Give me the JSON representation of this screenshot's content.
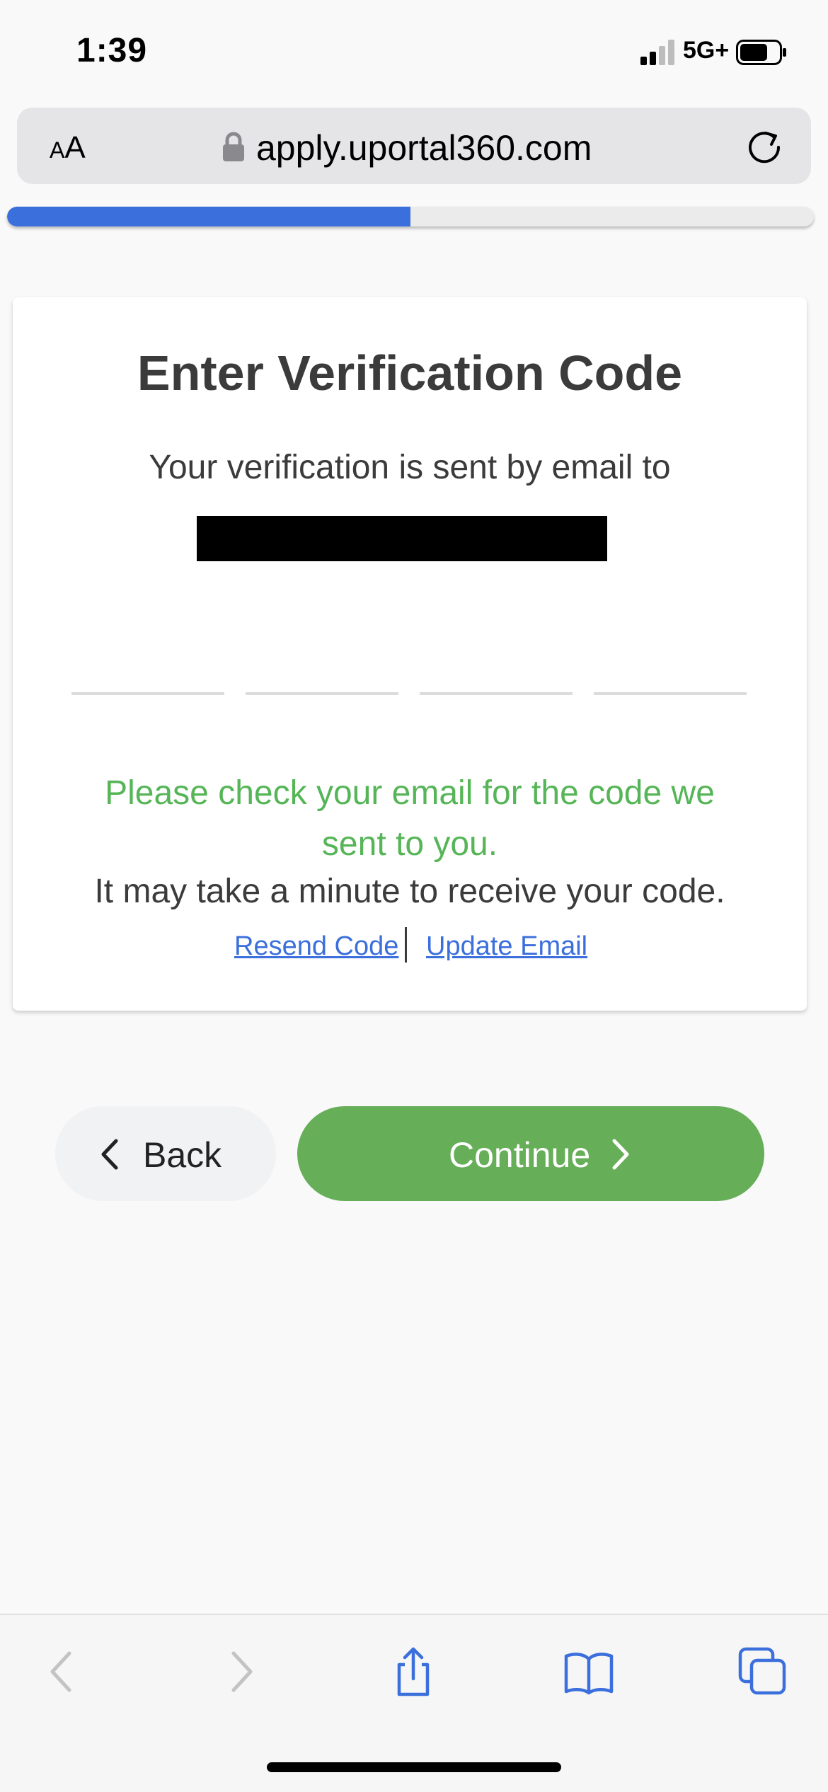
{
  "status_bar": {
    "time": "1:39",
    "network": "5G+"
  },
  "browser": {
    "aa_label_small": "A",
    "aa_label_large": "A",
    "url": "apply.uportal360.com"
  },
  "progress": {
    "fraction": 0.5
  },
  "card": {
    "title": "Enter Verification Code",
    "subtitle": "Your verification is sent by email to",
    "check_message": "Please check your email for the code we sent to you.",
    "wait_message": "It may take a minute to receive your code.",
    "resend_link": "Resend Code",
    "update_link": "Update Email"
  },
  "code_fields": [
    "",
    "",
    "",
    ""
  ],
  "buttons": {
    "back": "Back",
    "continue": "Continue"
  },
  "colors": {
    "accent": "#3b6fdc",
    "success": "#56b557",
    "continue": "#67ae59"
  },
  "toolbar_icons": [
    "back-arrow-icon",
    "forward-arrow-icon",
    "share-icon",
    "bookmarks-icon",
    "tabs-icon"
  ]
}
